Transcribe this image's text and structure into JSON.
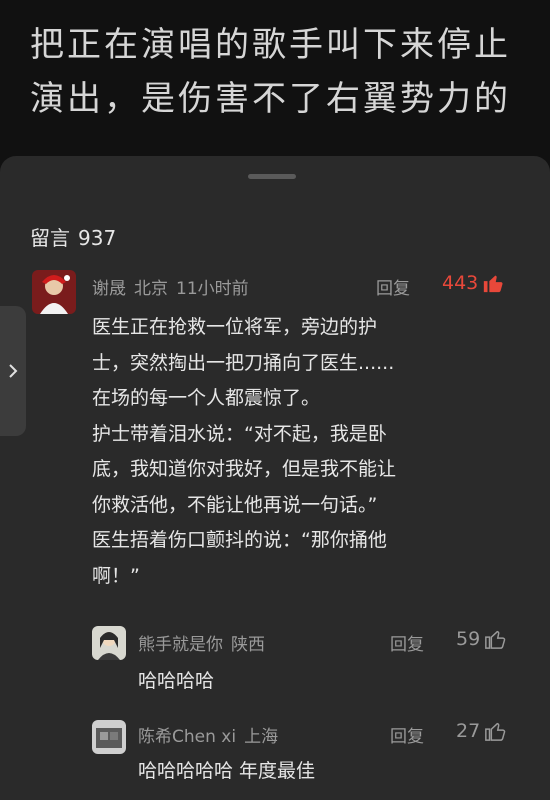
{
  "article": {
    "title": "把正在演唱的歌手叫下来停止演出，是伤害不了右翼势力的"
  },
  "comments_panel": {
    "label": "留言",
    "count": "937"
  },
  "comment": {
    "author": "谢晟",
    "location": "北京",
    "time": "11小时前",
    "reply_label": "回复",
    "likes": "443",
    "lines": [
      "医生正在抢救一位将军，旁边的护",
      "士，突然掏出一把刀捅向了医生......",
      "在场的每一个人都震惊了。",
      "护士带着泪水说：“对不起，我是卧",
      "底，我知道你对我好，但是我不能让",
      "你救活他，不能让他再说一句话。”",
      "医生捂着伤口颤抖的说：“那你捅他",
      "啊！”"
    ]
  },
  "replies": [
    {
      "author": "熊手就是你",
      "location": "陕西",
      "reply_label": "回复",
      "likes": "59",
      "text": "哈哈哈哈"
    },
    {
      "author": "陈希Chen xi",
      "location": "上海",
      "reply_label": "回复",
      "likes": "27",
      "text": "哈哈哈哈哈 年度最佳"
    }
  ],
  "icons": {
    "like_active": "thumbs-up-icon",
    "like_inactive": "thumbs-up-outline-icon",
    "side_arrow": "chevron-right-icon"
  },
  "colors": {
    "accent": "#e8483a",
    "background": "#111111",
    "panel": "#2a2a2a",
    "muted_text": "#9a9a9a"
  }
}
